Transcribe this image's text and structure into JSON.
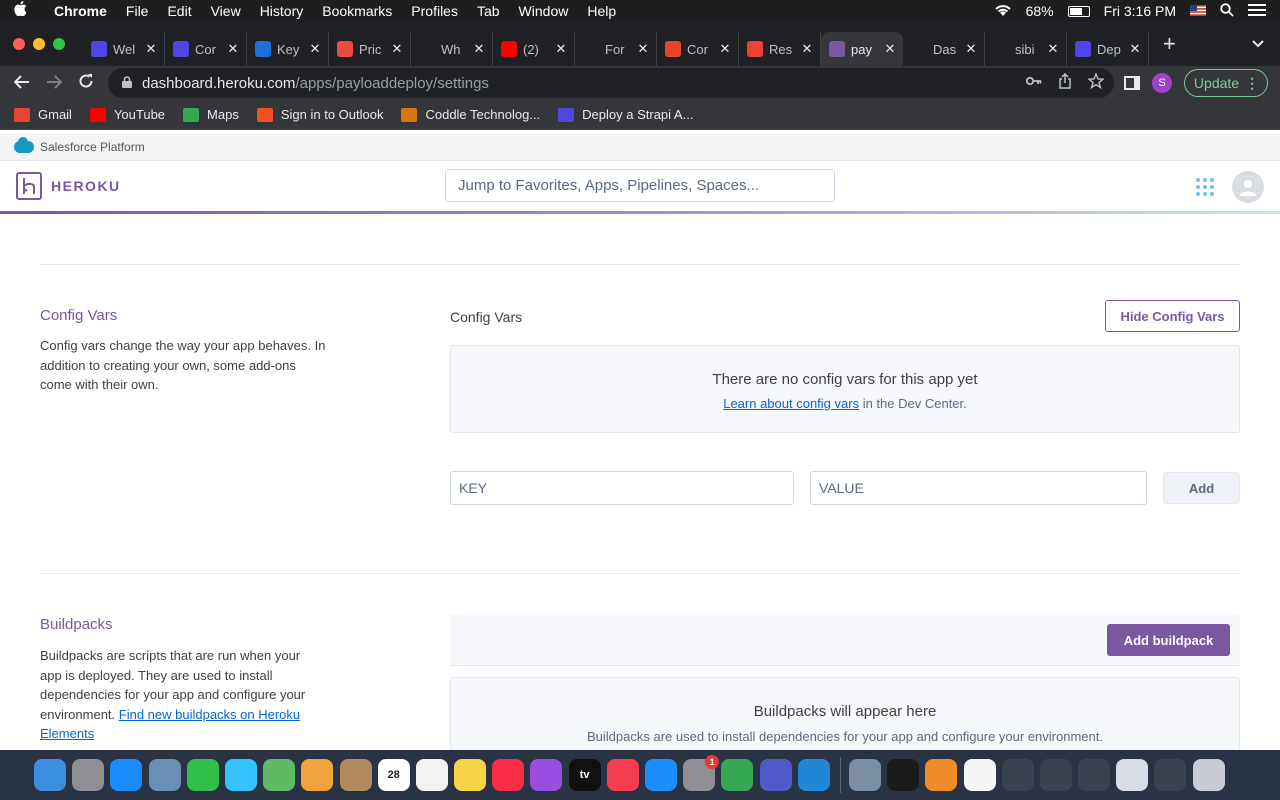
{
  "menubar": {
    "app": "Chrome",
    "items": [
      "File",
      "Edit",
      "View",
      "History",
      "Bookmarks",
      "Profiles",
      "Tab",
      "Window",
      "Help"
    ],
    "battery_percent": "68%",
    "battery_level": 0.68,
    "clock": "Fri 3:16 PM"
  },
  "tabs": [
    {
      "title": "Wel",
      "icon_color": "#4f46e5",
      "icon": "strapi-icon"
    },
    {
      "title": "Cor",
      "icon_color": "#4f46e5",
      "icon": "strapi-icon"
    },
    {
      "title": "Key",
      "icon_color": "#1e6fd9",
      "icon": "k-icon"
    },
    {
      "title": "Pric",
      "icon_color": "#e84d3d",
      "icon": "c-icon"
    },
    {
      "title": "Wh",
      "icon_color": "#202124",
      "icon": "payload-icon"
    },
    {
      "title": "(2)",
      "icon_color": "#ff0000",
      "icon": "youtube-icon"
    },
    {
      "title": "For",
      "icon_color": "#202124",
      "icon": "payload-icon"
    },
    {
      "title": "Cor",
      "icon_color": "#e8452c",
      "icon": "z-icon"
    },
    {
      "title": "Res",
      "icon_color": "#ea4335",
      "icon": "gmail-icon"
    },
    {
      "title": "pay",
      "icon_color": "#79589f",
      "icon": "heroku-icon",
      "active": true
    },
    {
      "title": "Das",
      "icon_color": "#202124",
      "icon": "payload-icon"
    },
    {
      "title": "sibi",
      "icon_color": "#202124",
      "icon": "github-icon"
    },
    {
      "title": "Dep",
      "icon_color": "#4f46e5",
      "icon": "strapi-icon"
    }
  ],
  "toolbar": {
    "url_host": "dashboard.heroku.com",
    "url_path": "/apps/payloaddeploy/settings",
    "profile_initial": "S",
    "update_label": "Update"
  },
  "bookmarks": [
    {
      "label": "Gmail",
      "icon": "gmail-icon",
      "color": "#ea4335"
    },
    {
      "label": "YouTube",
      "icon": "youtube-icon",
      "color": "#ff0000"
    },
    {
      "label": "Maps",
      "icon": "maps-icon",
      "color": "#34a853"
    },
    {
      "label": "Sign in to Outlook",
      "icon": "microsoft-icon",
      "color": "#f25022"
    },
    {
      "label": "Coddle Technolog...",
      "icon": "coddle-icon",
      "color": "#d97706"
    },
    {
      "label": "Deploy a Strapi A...",
      "icon": "strapi-icon",
      "color": "#4f46e5"
    }
  ],
  "salesforce": {
    "label": "Salesforce Platform"
  },
  "heroku": {
    "brand": "HEROKU",
    "search_placeholder": "Jump to Favorites, Apps, Pipelines, Spaces..."
  },
  "config_vars": {
    "title": "Config Vars",
    "description": "Config vars change the way your app behaves. In addition to creating your own, some add-ons come with their own.",
    "panel_label": "Config Vars",
    "hide_button": "Hide Config Vars",
    "empty_heading": "There are no config vars for this app yet",
    "empty_link": "Learn about config vars",
    "empty_suffix": " in the Dev Center.",
    "key_placeholder": "KEY",
    "value_placeholder": "VALUE",
    "add_button": "Add"
  },
  "buildpacks": {
    "title": "Buildpacks",
    "description": "Buildpacks are scripts that are run when your app is deployed. They are used to install dependencies for your app and configure your environment. ",
    "link": "Find new buildpacks on Heroku Elements",
    "add_button": "Add buildpack",
    "empty_heading": "Buildpacks will appear here",
    "empty_sub": "Buildpacks are used to install dependencies for your app and configure your environment."
  },
  "dock": [
    {
      "name": "finder-icon",
      "color": "#3b8fe0"
    },
    {
      "name": "launchpad-icon",
      "color": "#8e8e93"
    },
    {
      "name": "safari-icon",
      "color": "#1a8cff"
    },
    {
      "name": "preview-icon",
      "color": "#6a8fb5"
    },
    {
      "name": "facetime-icon",
      "color": "#2fbf4a"
    },
    {
      "name": "messages-icon",
      "color": "#34c3ff"
    },
    {
      "name": "maps-icon",
      "color": "#5dbb63"
    },
    {
      "name": "photos-icon",
      "color": "#f3a33c"
    },
    {
      "name": "contacts-icon",
      "color": "#b08a5c"
    },
    {
      "name": "calendar-icon",
      "color": "#ffffff",
      "text": "28"
    },
    {
      "name": "reminders-icon",
      "color": "#f2f2f2"
    },
    {
      "name": "notes-icon",
      "color": "#f7d547"
    },
    {
      "name": "music-icon",
      "color": "#fa2d48"
    },
    {
      "name": "podcasts-icon",
      "color": "#9a4de0"
    },
    {
      "name": "tv-icon",
      "color": "#111111",
      "text": "tv"
    },
    {
      "name": "news-icon",
      "color": "#f63c4f"
    },
    {
      "name": "appstore-icon",
      "color": "#1c8ef9"
    },
    {
      "name": "system-preferences-icon",
      "color": "#8e8e93",
      "badge": "1"
    },
    {
      "name": "chrome-icon",
      "color": "#34a853"
    },
    {
      "name": "teams-icon",
      "color": "#5059c9"
    },
    {
      "name": "vscode-icon",
      "color": "#1f87d6"
    },
    {
      "sep": true
    },
    {
      "name": "preview-doc-icon",
      "color": "#7b8ea6"
    },
    {
      "name": "terminal-icon",
      "color": "#1b1b1b"
    },
    {
      "name": "home-folder-icon",
      "color": "#f08b2a"
    },
    {
      "name": "document-icon",
      "color": "#f5f5f5"
    },
    {
      "name": "window-thumbnail-icon",
      "color": "#3a4250"
    },
    {
      "name": "window-thumbnail-icon",
      "color": "#3a4250"
    },
    {
      "name": "window-thumbnail-icon",
      "color": "#3a4250"
    },
    {
      "name": "window-thumbnail-icon",
      "color": "#d8dde6"
    },
    {
      "name": "window-thumbnail-icon",
      "color": "#3a4250"
    },
    {
      "name": "trash-icon",
      "color": "#c8ccd2"
    }
  ]
}
